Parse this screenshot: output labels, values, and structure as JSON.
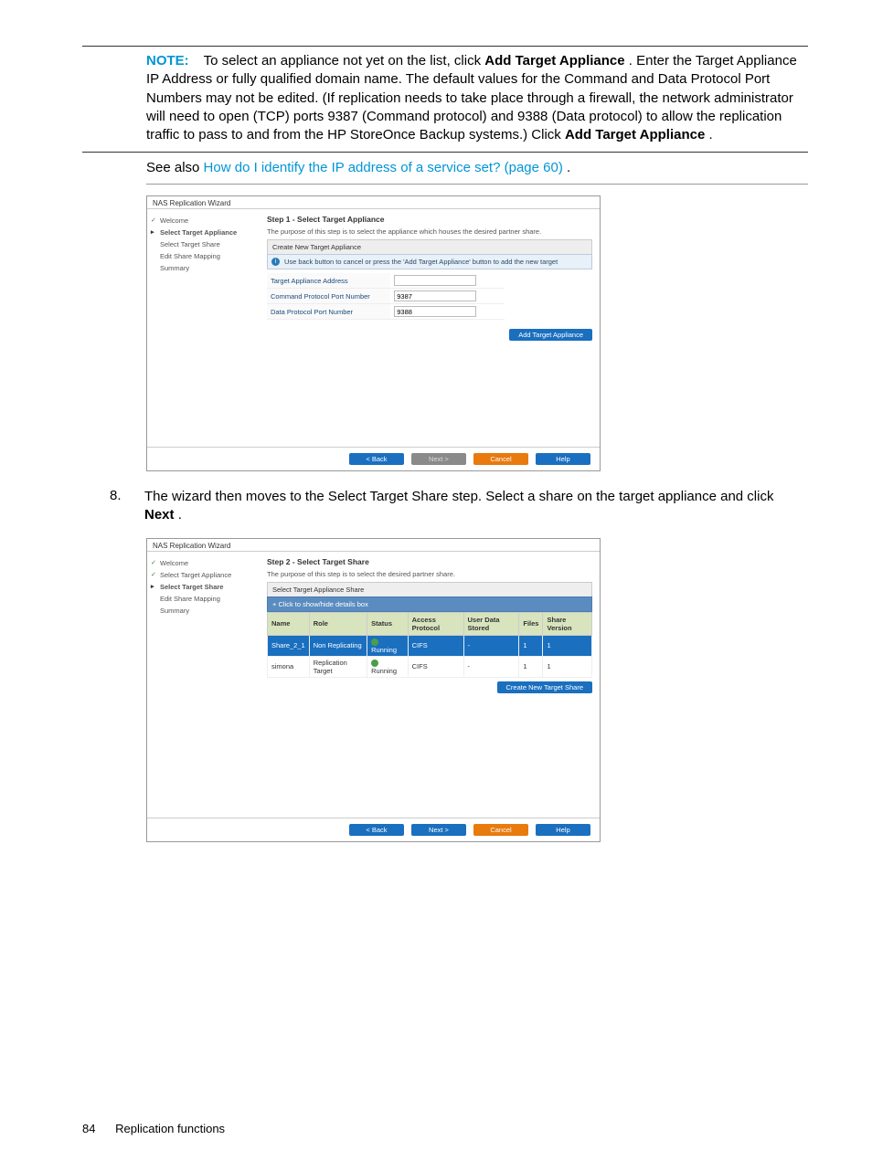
{
  "note": {
    "label": "NOTE:",
    "text_prefix": "To select an appliance not yet on the list, click ",
    "bold1": "Add Target Appliance",
    "text_mid": ". Enter the Target Appliance IP Address or fully qualified domain name. The default values for the Command and Data Protocol Port Numbers may not be edited. (If replication needs to take place through a firewall, the network administrator will need to open (TCP) ports 9387 (Command protocol) and 9388 (Data protocol) to allow the replication traffic to pass to and from the HP StoreOnce Backup systems.) Click ",
    "bold2": "Add Target Appliance",
    "text_suffix": "."
  },
  "see_also": {
    "prefix": "See also ",
    "link": "How do I identify the IP address of a service set? (page 60)",
    "suffix": "."
  },
  "wizard1": {
    "window_title": "NAS Replication Wizard",
    "sidebar": {
      "items": [
        "Welcome",
        "Select Target Appliance",
        "Select Target Share",
        "Edit Share Mapping",
        "Summary"
      ],
      "done_index": 0,
      "active_index": 1
    },
    "step_title": "Step 1 - Select Target Appliance",
    "step_desc": "The purpose of this step is to select the appliance which houses the desired partner share.",
    "panel_header": "Create New Target Appliance",
    "info_text": "Use back button to cancel or press the 'Add Target Appliance' button to add the new target",
    "form": {
      "rows": [
        {
          "label": "Target Appliance Address",
          "value": ""
        },
        {
          "label": "Command Protocol Port Number",
          "value": "9387"
        },
        {
          "label": "Data Protocol Port Number",
          "value": "9388"
        }
      ]
    },
    "add_button": "Add Target Appliance",
    "footer": {
      "back": "< Back",
      "next": "Next >",
      "cancel": "Cancel",
      "help": "Help"
    }
  },
  "step8": {
    "number": "8.",
    "text_prefix": "The wizard then moves to the Select Target Share step. Select a share on the target appliance and click ",
    "bold": "Next",
    "text_suffix": "."
  },
  "wizard2": {
    "window_title": "NAS Replication Wizard",
    "sidebar": {
      "items": [
        "Welcome",
        "Select Target Appliance",
        "Select Target Share",
        "Edit Share Mapping",
        "Summary"
      ],
      "done_indices": [
        0,
        1
      ],
      "active_index": 2
    },
    "step_title": "Step 2 - Select Target Share",
    "step_desc": "The purpose of this step is to select the desired partner share.",
    "panel_header": "Select Target Appliance Share",
    "details_toggle": "+ Click to show/hide details box",
    "table": {
      "columns": [
        "Name",
        "Role",
        "Status",
        "Access Protocol",
        "User Data Stored",
        "Files",
        "Share Version"
      ],
      "rows": [
        {
          "name": "Share_2_1",
          "role": "Non Replicating",
          "status": "Running",
          "protocol": "CIFS",
          "stored": "-",
          "files": "1",
          "version": "1",
          "selected": true
        },
        {
          "name": "simona",
          "role": "Replication Target",
          "status": "Running",
          "protocol": "CIFS",
          "stored": "-",
          "files": "1",
          "version": "1",
          "selected": false
        }
      ]
    },
    "create_button": "Create New Target Share",
    "footer": {
      "back": "< Back",
      "next": "Next >",
      "cancel": "Cancel",
      "help": "Help"
    }
  },
  "footer": {
    "page_number": "84",
    "section": "Replication functions"
  }
}
